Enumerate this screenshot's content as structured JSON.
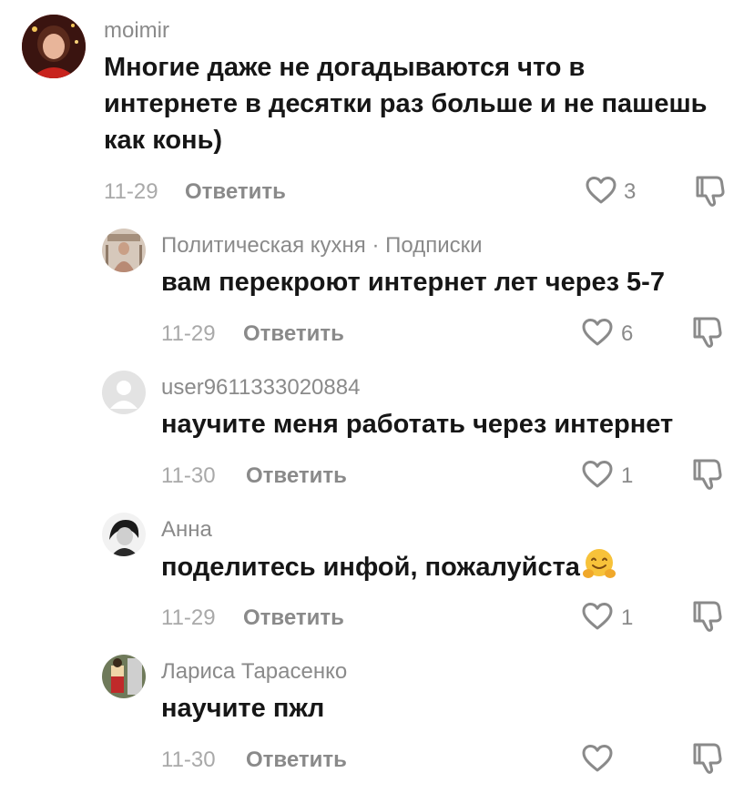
{
  "comments": [
    {
      "username": "moimir",
      "lines": [
        "Многие даже не догадываются что в",
        "интернете  в десятки раз больше и не пашешь",
        "как конь)"
      ],
      "date": "11-29",
      "reply_label": "Ответить",
      "likes": "3"
    },
    {
      "username": "Политическая кухня · Подписки",
      "lines": [
        "вам перекроют интернет лет через 5-7"
      ],
      "date": "11-29",
      "reply_label": "Ответить",
      "likes": "6"
    },
    {
      "username": "user9611333020884",
      "lines": [
        "научите меня работать через интернет"
      ],
      "date": "11-30",
      "reply_label": "Ответить",
      "likes": "1"
    },
    {
      "username": "Анна",
      "lines": [
        "поделитесь инфой, пожалуйста"
      ],
      "emoji": "hugging-face-emoji",
      "date": "11-29",
      "reply_label": "Ответить",
      "likes": "1"
    },
    {
      "username": "Лариса Тарасенко",
      "lines": [
        "научите пжл"
      ],
      "date": "11-30",
      "reply_label": "Ответить",
      "likes": ""
    }
  ],
  "icons": {
    "like": "heart-outline-icon",
    "dislike": "thumbs-down-outline-icon"
  },
  "colors": {
    "text": "#161616",
    "muted": "#8a8a8a",
    "date": "#a9a9a9"
  }
}
